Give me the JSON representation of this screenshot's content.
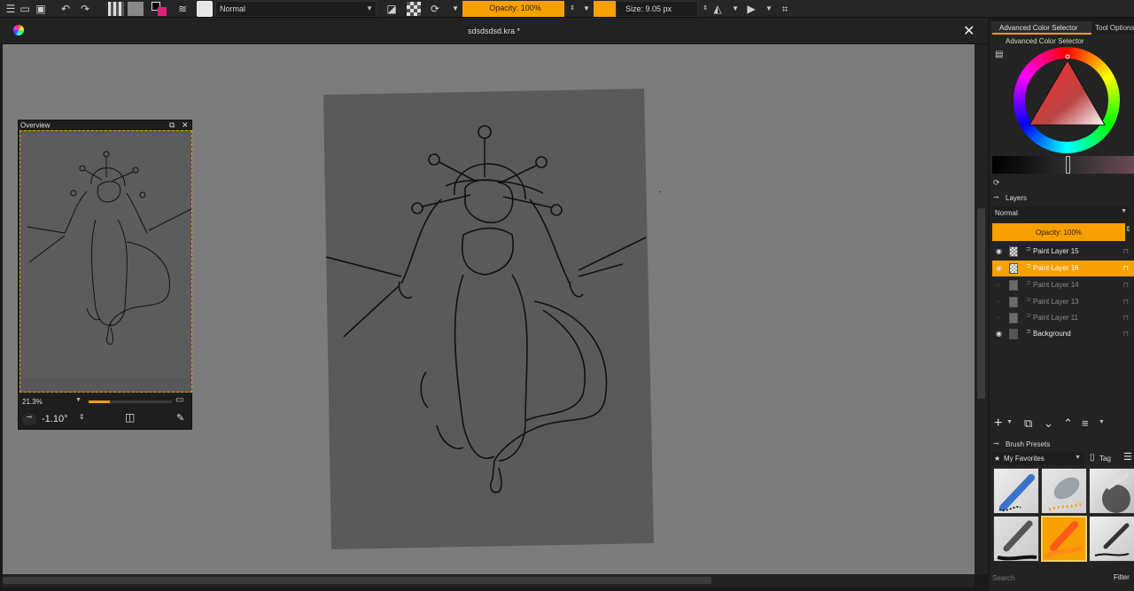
{
  "toolbar": {
    "blend_mode": "Normal",
    "opacity": "Opacity: 100%",
    "size": "Size: 9.05 px"
  },
  "document": {
    "title": "sdsdsdsd.kra *"
  },
  "overview": {
    "title": "Overview",
    "zoom": "21.3%",
    "rotation": "-1.10°"
  },
  "right_panel": {
    "tabs": [
      "Advanced Color Selector",
      "Tool Options"
    ],
    "color_selector_title": "Advanced Color Selector",
    "layers_title": "Layers",
    "layers_blend": "Normal",
    "layers_opacity": "Opacity:  100%",
    "layers": [
      {
        "name": "Paint Layer 15",
        "visible": true,
        "selected": false
      },
      {
        "name": "Paint Layer 16",
        "visible": true,
        "selected": true
      },
      {
        "name": "Paint Layer 14",
        "visible": false,
        "selected": false
      },
      {
        "name": "Paint Layer 13",
        "visible": false,
        "selected": false
      },
      {
        "name": "Paint Layer 11",
        "visible": false,
        "selected": false
      },
      {
        "name": "Background",
        "visible": true,
        "selected": false
      }
    ],
    "brush_presets_title": "Brush Presets",
    "brush_presets_tag": "My Favorites",
    "tag_label": "Tag",
    "search_placeholder": "Search",
    "filter_label": "Filter"
  },
  "colors": {
    "accent": "#f7a000",
    "canvas_bg": "#7c7c7c",
    "paper": "#5a5a5a"
  }
}
